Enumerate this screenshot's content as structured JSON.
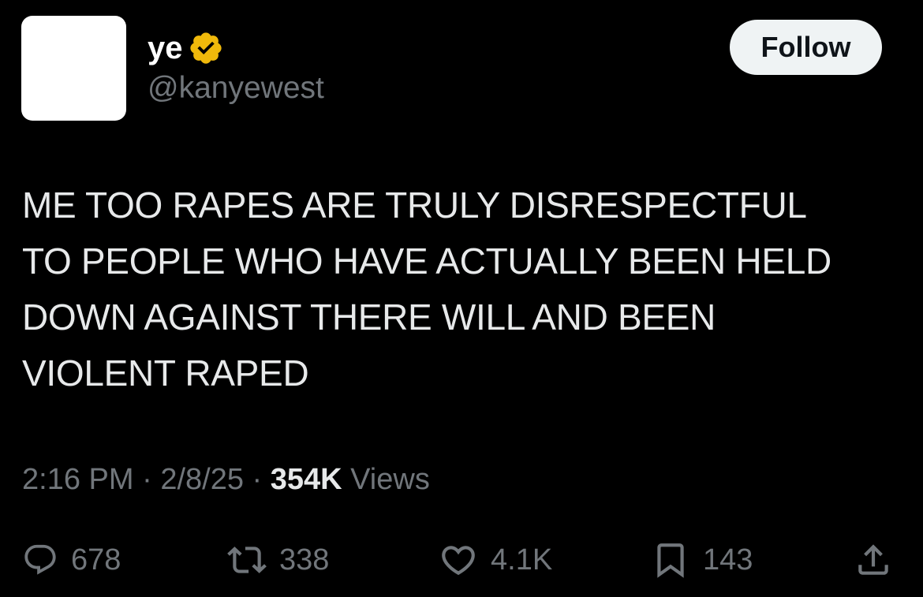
{
  "user": {
    "display_name": "ye",
    "handle": "@kanyewest",
    "verified_badge_color": "#f0b90b"
  },
  "follow_button": {
    "label": "Follow"
  },
  "tweet": {
    "text": "ME TOO RAPES ARE TRULY DISRESPECTFUL\nTO PEOPLE WHO HAVE ACTUALLY BEEN HELD\nDOWN AGAINST THERE WILL AND BEEN\nVIOLENT RAPED",
    "time": "2:16 PM",
    "date": "2/8/25",
    "separator": " · ",
    "views_count": "354K",
    "views_label": " Views"
  },
  "actions": {
    "replies": "678",
    "retweets": "338",
    "likes": "4.1K",
    "bookmarks": "143"
  },
  "icons": {
    "reply": "reply-icon",
    "retweet": "retweet-icon",
    "like": "heart-icon",
    "bookmark": "bookmark-icon",
    "share": "share-icon",
    "verified": "verified-badge-icon"
  },
  "colors": {
    "background": "#000000",
    "text_primary": "#e7e9ea",
    "text_secondary": "#71767b",
    "follow_bg": "#eff3f4",
    "follow_text": "#0f1419"
  }
}
